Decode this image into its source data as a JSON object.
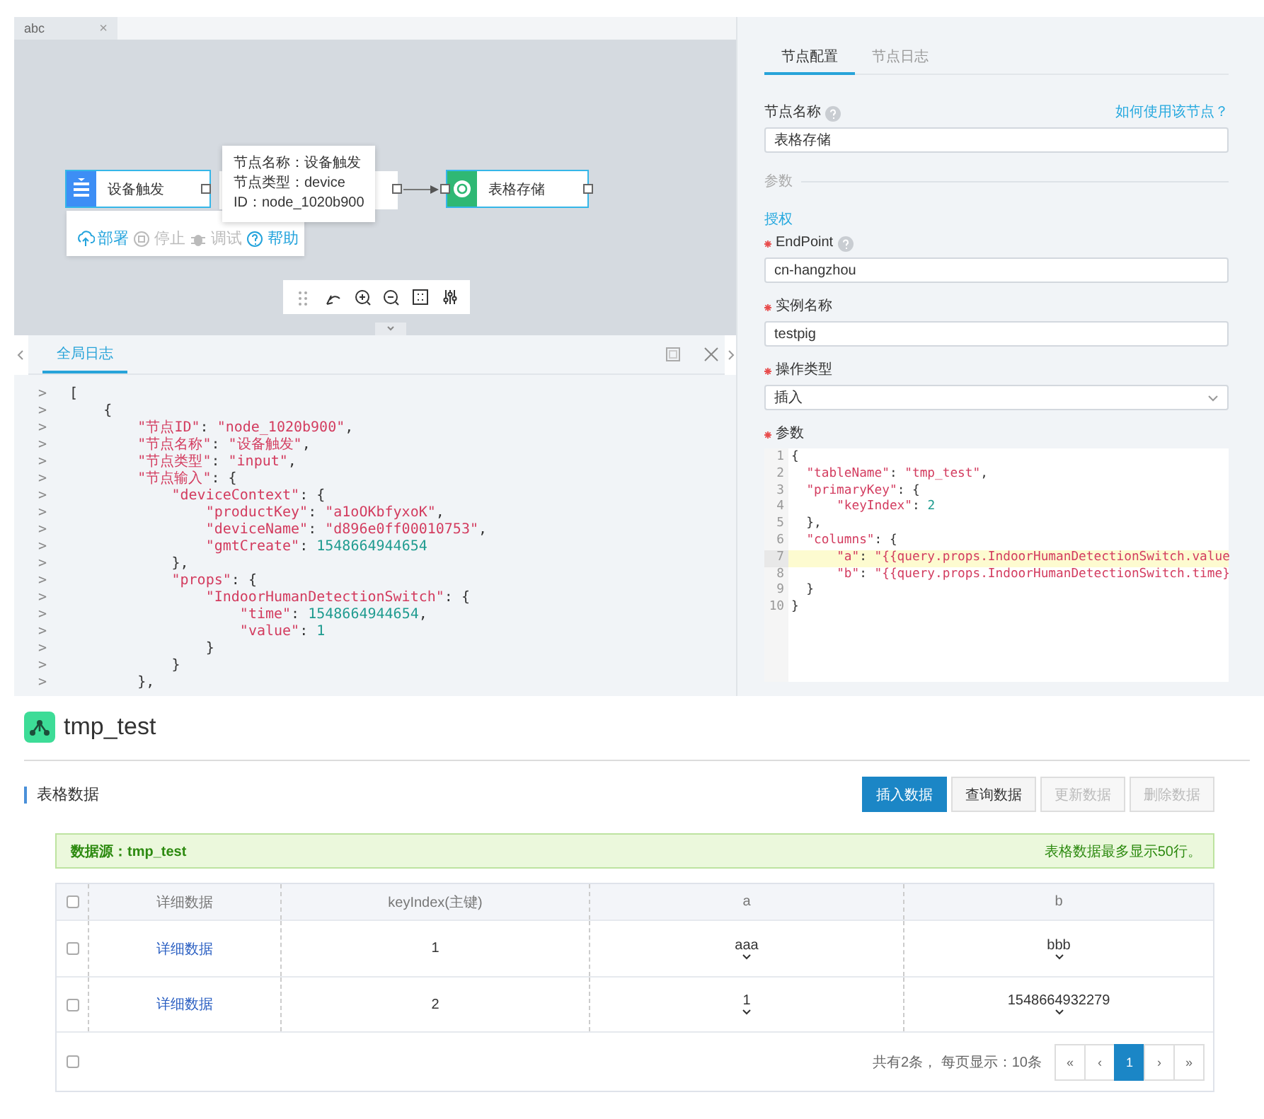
{
  "editor": {
    "tabs": [
      {
        "label": "abc",
        "close": "×",
        "selected": true
      }
    ],
    "nodes": [
      {
        "kind": "device",
        "label": "设备触发"
      },
      {
        "kind": "plain"
      },
      {
        "kind": "table",
        "label": "表格存储"
      }
    ],
    "tooltip": [
      "节点名称：设备触发",
      "节点类型：device",
      "ID：node_1020b900"
    ],
    "node_menu": [
      {
        "kind": "deploy",
        "label": "部署",
        "disabled": false
      },
      {
        "kind": "stop",
        "label": "停止",
        "disabled": true
      },
      {
        "kind": "debug",
        "label": "调试",
        "disabled": true
      },
      {
        "kind": "help",
        "label": "帮助",
        "disabled": false
      }
    ]
  },
  "log": {
    "tabs": [
      {
        "label": "全局日志",
        "selected": true
      }
    ],
    "lines": [
      {
        "gutter": ">",
        "code": "["
      },
      {
        "gutter": ">",
        "code": "    {"
      },
      {
        "gutter": ">",
        "code": "        \"节点ID\": \"node_1020b900\","
      },
      {
        "gutter": ">",
        "code": "        \"节点名称\": \"设备触发\","
      },
      {
        "gutter": ">",
        "code": "        \"节点类型\": \"input\","
      },
      {
        "gutter": ">",
        "code": "        \"节点输入\": {"
      },
      {
        "gutter": ">",
        "code": "            \"deviceContext\": {"
      },
      {
        "gutter": ">",
        "code": "                \"productKey\": \"a1oOKbfyxoK\","
      },
      {
        "gutter": ">",
        "code": "                \"deviceName\": \"d896e0ff00010753\","
      },
      {
        "gutter": ">",
        "code": "                \"gmtCreate\": 1548664944654"
      },
      {
        "gutter": ">",
        "code": "            },"
      },
      {
        "gutter": ">",
        "code": "            \"props\": {"
      },
      {
        "gutter": ">",
        "code": "                \"IndoorHumanDetectionSwitch\": {"
      },
      {
        "gutter": ">",
        "code": "                    \"time\": 1548664944654,"
      },
      {
        "gutter": ">",
        "code": "                    \"value\": 1"
      },
      {
        "gutter": ">",
        "code": "                }"
      },
      {
        "gutter": ">",
        "code": "            }"
      },
      {
        "gutter": ">",
        "code": "        },"
      }
    ]
  },
  "config": {
    "tabs": [
      {
        "label": "节点配置",
        "selected": true
      },
      {
        "label": "节点日志",
        "selected": false
      }
    ],
    "fields": [
      {
        "kind": "input",
        "label": "节点名称",
        "required": false,
        "help": true,
        "aside_link": "如何使用该节点？",
        "value": "表格存储"
      },
      {
        "kind": "divider",
        "label": "参数"
      },
      {
        "kind": "link",
        "label": "授权"
      },
      {
        "kind": "input",
        "label": "EndPoint",
        "required": true,
        "help": true,
        "value": "cn-hangzhou"
      },
      {
        "kind": "input",
        "label": "实例名称",
        "required": true,
        "help": false,
        "value": "testpig"
      },
      {
        "kind": "select",
        "label": "操作类型",
        "required": true,
        "help": false,
        "value": "插入"
      },
      {
        "kind": "code",
        "label": "参数",
        "required": true,
        "help": false,
        "lines": [
          {
            "number": "1",
            "code": "{",
            "highlighted": false
          },
          {
            "number": "2",
            "code": "  \"tableName\": \"tmp_test\",",
            "highlighted": false
          },
          {
            "number": "3",
            "code": "  \"primaryKey\": {",
            "highlighted": false
          },
          {
            "number": "4",
            "code": "      \"keyIndex\": 2",
            "highlighted": false
          },
          {
            "number": "5",
            "code": "  },",
            "highlighted": false
          },
          {
            "number": "6",
            "code": "  \"columns\": {",
            "highlighted": false
          },
          {
            "number": "7",
            "code": "      \"a\": \"{{query.props.IndoorHumanDetectionSwitch.value",
            "highlighted": true
          },
          {
            "number": "8",
            "code": "      \"b\": \"{{query.props.IndoorHumanDetectionSwitch.time}",
            "highlighted": false
          },
          {
            "number": "9",
            "code": "  }",
            "highlighted": false
          },
          {
            "number": "10",
            "code": "}",
            "highlighted": false
          }
        ]
      }
    ]
  },
  "data": {
    "title": "tmp_test",
    "section": "表格数据",
    "buttons": [
      {
        "label": "插入数据",
        "kind": "primary",
        "disabled": false
      },
      {
        "label": "查询数据",
        "kind": "default",
        "disabled": false
      },
      {
        "label": "更新数据",
        "kind": "default",
        "disabled": true
      },
      {
        "label": "删除数据",
        "kind": "default",
        "disabled": true
      }
    ],
    "alert": {
      "source": "数据源：tmp_test",
      "note": "表格数据最多显示50行。"
    },
    "header_checked": false,
    "columns": [
      "详细数据",
      "keyIndex(主键)",
      "a",
      "b"
    ],
    "rows": [
      {
        "checked": false,
        "cells": [
          "详细数据",
          "1",
          "aaa",
          "bbb"
        ]
      },
      {
        "checked": false,
        "cells": [
          "详细数据",
          "2",
          "1",
          "1548664932279"
        ]
      }
    ],
    "footer": {
      "checked": false,
      "summary": "共有2条， 每页显示：10条",
      "pages": [
        {
          "label": "«",
          "selected": false
        },
        {
          "label": "‹",
          "selected": false
        },
        {
          "label": "1",
          "selected": true
        },
        {
          "label": "›",
          "selected": false
        },
        {
          "label": "»",
          "selected": false
        }
      ]
    }
  }
}
